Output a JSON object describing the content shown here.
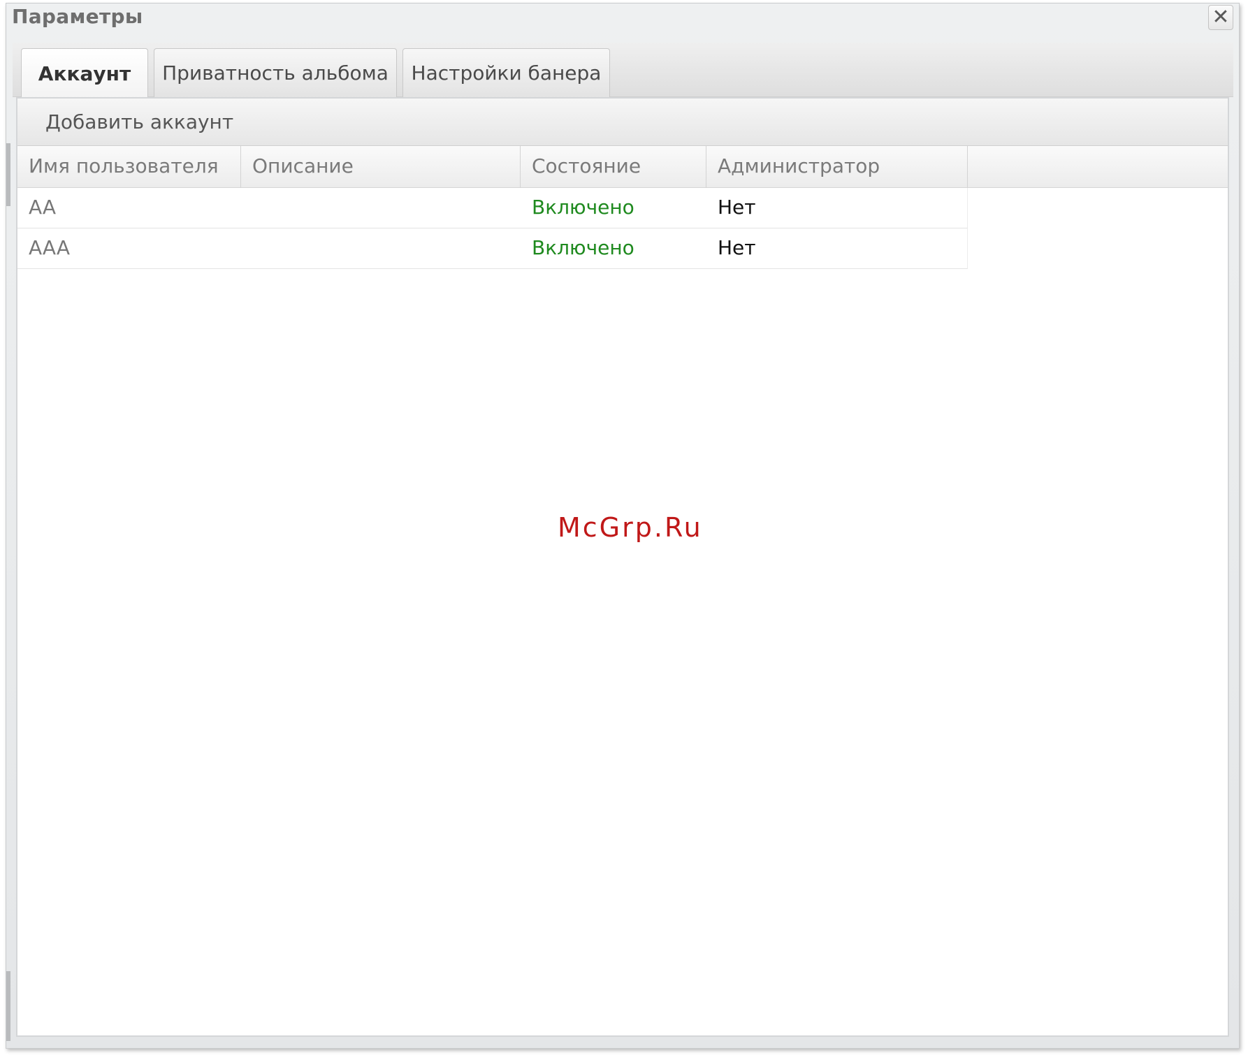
{
  "window": {
    "title": "Параметры"
  },
  "tabs": [
    {
      "label": "Аккаунт",
      "active": true
    },
    {
      "label": "Приватность альбома",
      "active": false
    },
    {
      "label": "Настройки банера",
      "active": false
    }
  ],
  "toolbar": {
    "add_account_label": "Добавить аккаунт"
  },
  "grid": {
    "columns": [
      "Имя пользователя",
      "Описание",
      "Состояние",
      "Администратор"
    ],
    "rows": [
      {
        "user": "AA",
        "description": "",
        "state": "Включено",
        "admin": "Нет"
      },
      {
        "user": "AAA",
        "description": "",
        "state": "Включено",
        "admin": "Нет"
      }
    ]
  },
  "watermark": "McGrp.Ru",
  "colors": {
    "state_enabled": "#1f8a1f",
    "watermark": "#c01818"
  },
  "icons": {
    "close": "close-icon"
  }
}
